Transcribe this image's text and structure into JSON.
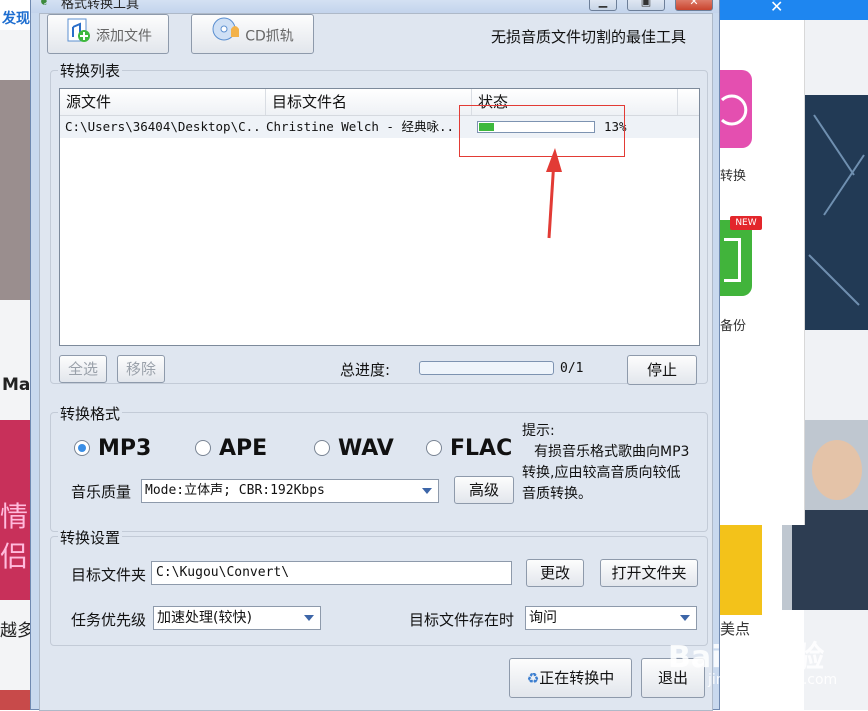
{
  "background": {
    "left_texts": [
      "发现",
      "May",
      "情侣",
      "越多"
    ],
    "tools": [
      {
        "label": "转换",
        "icon": "convert-icon",
        "color": "#e44fb0"
      },
      {
        "label": "备份",
        "icon": "backup-icon",
        "color": "#41b43b",
        "badge": "NEW"
      }
    ],
    "right_label": "美点",
    "watermark": "Baidu经验",
    "watermark_url": "jingyan.baidu.com"
  },
  "dialog": {
    "title": "格式转换工具",
    "toolbar": {
      "add_file": "添加文件",
      "cd_rip": "CD抓轨",
      "slogan": "无损音质文件切割的最佳工具"
    },
    "list_group": {
      "title": "转换列表",
      "columns": [
        "源文件",
        "目标文件名",
        "状态"
      ],
      "rows": [
        {
          "source": "C:\\Users\\36404\\Desktop\\C..",
          "target": "Christine Welch - 经典咏..",
          "progress": 0.13,
          "percent": "13%"
        }
      ],
      "select_all": "全选",
      "remove": "移除",
      "total_label": "总进度:",
      "total_count": "0/1",
      "total_progress": 0,
      "stop": "停止"
    },
    "format_group": {
      "title": "转换格式",
      "formats": [
        "MP3",
        "APE",
        "WAV",
        "FLAC"
      ],
      "selected": "MP3",
      "quality_label": "音乐质量",
      "quality_value": "Mode:立体声; CBR:192Kbps",
      "advanced": "高级",
      "hint_title": "提示:",
      "hint_lines": [
        "有损音乐格式歌曲向MP3",
        "转换,应由较高音质向较低",
        "音质转换。"
      ]
    },
    "settings_group": {
      "title": "转换设置",
      "target_folder_label": "目标文件夹",
      "target_folder_value": "C:\\Kugou\\Convert\\",
      "change": "更改",
      "open_folder": "打开文件夹",
      "priority_label": "任务优先级",
      "priority_value": "加速处理(较快)",
      "exists_label": "目标文件存在时",
      "exists_value": "询问"
    },
    "converting": "正在转换中",
    "exit": "退出"
  }
}
